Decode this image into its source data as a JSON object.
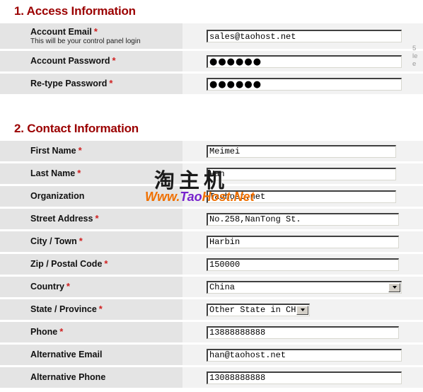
{
  "sections": [
    {
      "id": "access",
      "title": "1. Access Information",
      "fields": [
        {
          "label": "Account Email",
          "required": true,
          "hint": "This will be your control panel login",
          "type": "text",
          "value": "sales@taohost.net"
        },
        {
          "label": "Account Password",
          "required": true,
          "hint": "",
          "type": "password",
          "value": "●●●●●●"
        },
        {
          "label": "Re-type Password",
          "required": true,
          "hint": "",
          "type": "password",
          "value": "●●●●●●"
        }
      ]
    },
    {
      "id": "contact",
      "title": "2. Contact Information",
      "fields": [
        {
          "label": "First Name",
          "required": true,
          "hint": "",
          "type": "text",
          "value": "Meimei"
        },
        {
          "label": "Last Name",
          "required": true,
          "hint": "",
          "type": "text",
          "value": "Han"
        },
        {
          "label": "Organization",
          "required": false,
          "hint": "",
          "type": "text",
          "value": "Taohost.net"
        },
        {
          "label": "Street Address",
          "required": true,
          "hint": "",
          "type": "text",
          "value": "No.258,NanTong St."
        },
        {
          "label": "City / Town",
          "required": true,
          "hint": "",
          "type": "text",
          "value": "Harbin"
        },
        {
          "label": "Zip / Postal Code",
          "required": true,
          "hint": "",
          "type": "text",
          "value": "150000"
        },
        {
          "label": "Country",
          "required": true,
          "hint": "",
          "type": "select",
          "value": "China"
        },
        {
          "label": "State / Province",
          "required": true,
          "hint": "",
          "type": "select",
          "value": "Other State in CHN"
        },
        {
          "label": "Phone",
          "required": true,
          "hint": "",
          "type": "text",
          "value": "13888888888"
        },
        {
          "label": "Alternative Email",
          "required": false,
          "hint": "",
          "type": "text",
          "value": "han@taohost.net"
        },
        {
          "label": "Alternative Phone",
          "required": false,
          "hint": "",
          "type": "text",
          "value": "13088888888"
        }
      ]
    }
  ],
  "required_marker": "*",
  "edge_hint": {
    "line1": "5",
    "line2": "le",
    "line3": "e"
  },
  "watermark": {
    "chinese": "淘主机",
    "url_part1": "Www.",
    "url_part2": "Tao",
    "url_part3": "Host.Net"
  },
  "colors": {
    "heading": "#9b0000",
    "required": "#d02020",
    "label_bg": "#e4e4e4",
    "row_bg": "#f2f2f2",
    "watermark_orange": "#f07000",
    "watermark_purple": "#7722cc"
  }
}
